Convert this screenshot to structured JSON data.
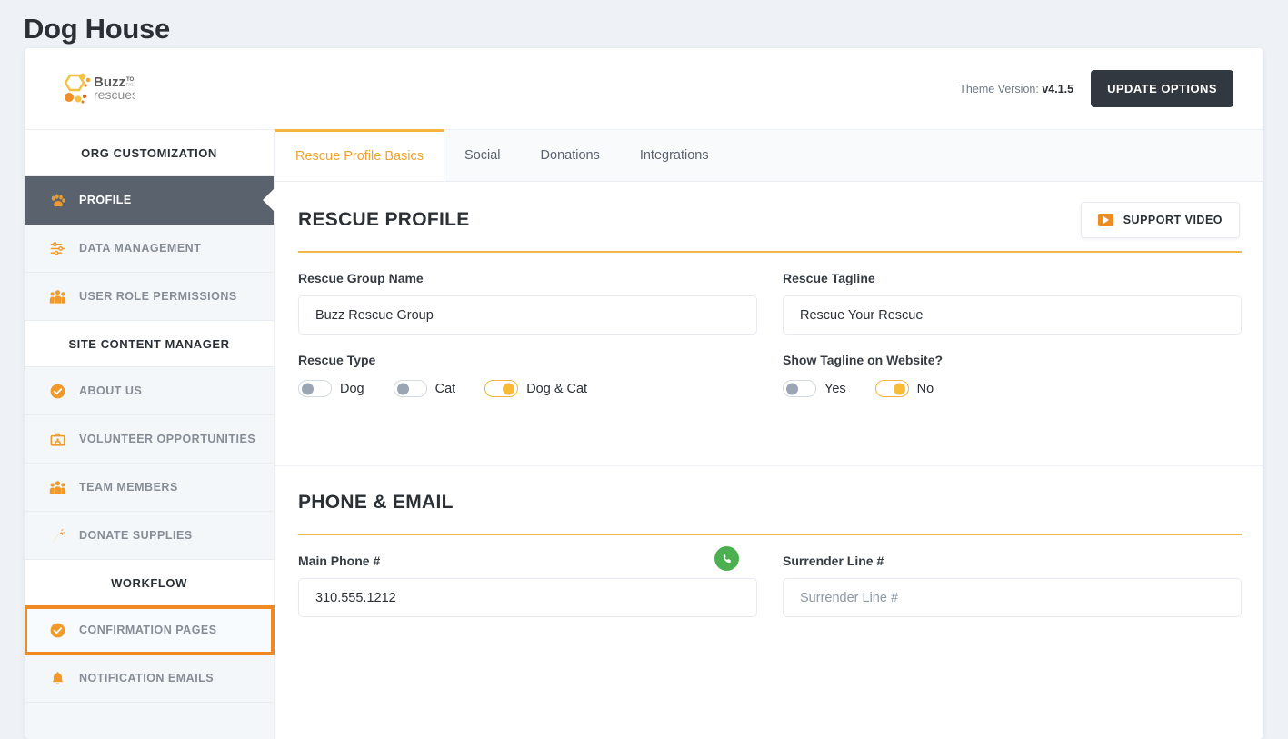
{
  "page": {
    "title": "Dog House"
  },
  "topbar": {
    "logo_text": "Buzz to the rescues",
    "theme_version_label": "Theme Version:",
    "theme_version_value": "v4.1.5",
    "update_button": "UPDATE OPTIONS"
  },
  "sidebar": {
    "sections": [
      {
        "header": "ORG CUSTOMIZATION",
        "items": [
          {
            "label": "PROFILE",
            "icon": "paw-icon",
            "state": "active"
          },
          {
            "label": "DATA MANAGEMENT",
            "icon": "sliders-icon",
            "state": "normal"
          },
          {
            "label": "USER ROLE PERMISSIONS",
            "icon": "people-icon",
            "state": "normal"
          }
        ]
      },
      {
        "header": "SITE CONTENT MANAGER",
        "items": [
          {
            "label": "ABOUT US",
            "icon": "check-circle-icon",
            "state": "normal"
          },
          {
            "label": "VOLUNTEER OPPORTUNITIES",
            "icon": "id-badge-icon",
            "state": "normal"
          },
          {
            "label": "TEAM MEMBERS",
            "icon": "people-icon",
            "state": "normal"
          },
          {
            "label": "DONATE SUPPLIES",
            "icon": "carrot-icon",
            "state": "normal"
          }
        ]
      },
      {
        "header": "WORKFLOW",
        "items": [
          {
            "label": "CONFIRMATION PAGES",
            "icon": "check-circle-icon",
            "state": "highlighted"
          },
          {
            "label": "NOTIFICATION EMAILS",
            "icon": "bell-icon",
            "state": "normal"
          }
        ]
      }
    ]
  },
  "tabs": [
    {
      "label": "Rescue Profile Basics",
      "active": true
    },
    {
      "label": "Social",
      "active": false
    },
    {
      "label": "Donations",
      "active": false
    },
    {
      "label": "Integrations",
      "active": false
    }
  ],
  "sections": [
    {
      "title": "RESCUE PROFILE",
      "support_button": "SUPPORT VIDEO",
      "fields": {
        "group_name_label": "Rescue Group Name",
        "group_name_value": "Buzz Rescue Group",
        "tagline_label": "Rescue Tagline",
        "tagline_value": "Rescue Your Rescue",
        "rescue_type_label": "Rescue Type",
        "rescue_type_options": [
          {
            "label": "Dog",
            "on": false
          },
          {
            "label": "Cat",
            "on": false
          },
          {
            "label": "Dog & Cat",
            "on": true
          }
        ],
        "show_tagline_label": "Show Tagline on Website?",
        "show_tagline_options": [
          {
            "label": "Yes",
            "on": false
          },
          {
            "label": "No",
            "on": true
          }
        ]
      }
    },
    {
      "title": "PHONE & EMAIL",
      "fields": {
        "main_phone_label": "Main Phone #",
        "main_phone_value": "310.555.1212",
        "surrender_label": "Surrender Line #",
        "surrender_placeholder": "Surrender Line #"
      }
    }
  ],
  "colors": {
    "accent_orange": "#ef8922",
    "accent_yellow": "#f5b23c",
    "dark_slate": "#5a636d",
    "success_green": "#4cb050"
  }
}
